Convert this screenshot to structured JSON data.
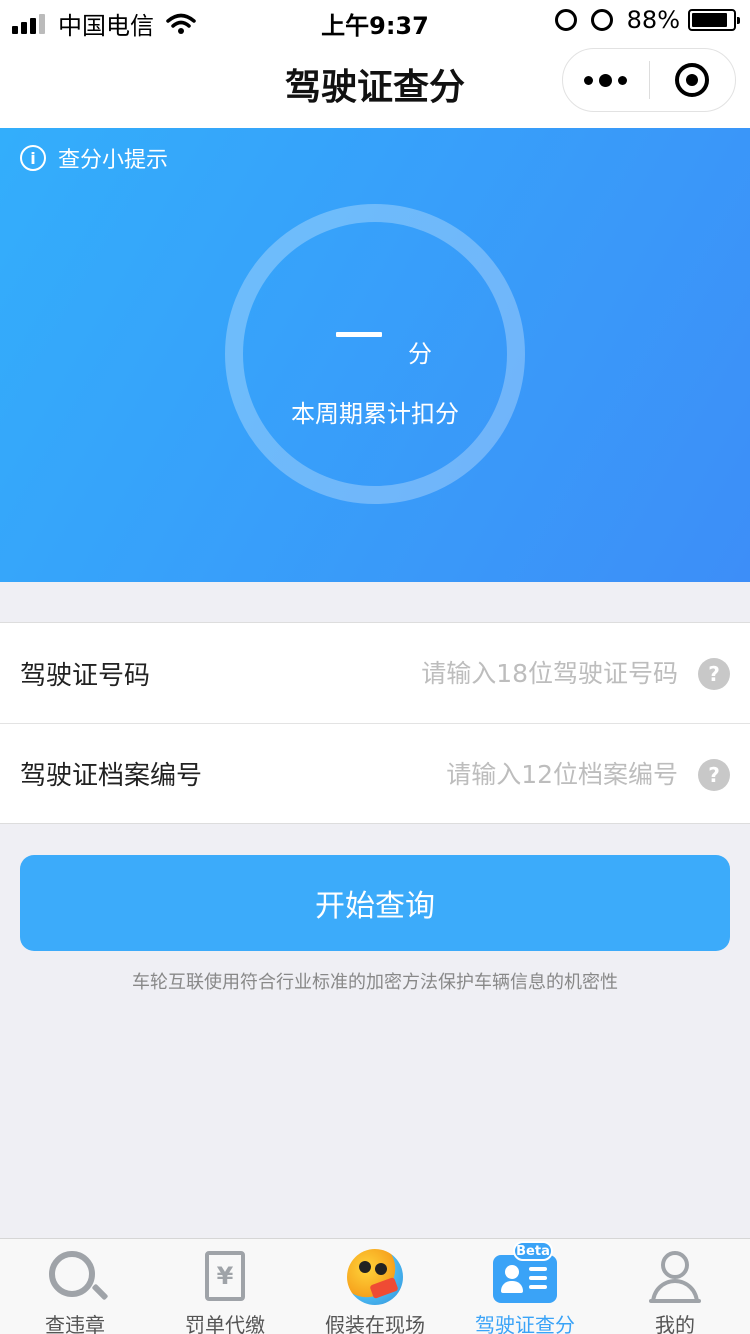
{
  "status_bar": {
    "carrier": "中国电信",
    "time": "上午9:37",
    "battery": "88%",
    "battery_level": 0.88,
    "signal_bars": 3
  },
  "nav": {
    "title": "驾驶证查分",
    "more_icon": "more-dots-icon",
    "close_icon": "target-close-icon"
  },
  "hero": {
    "tip_label": "查分小提示",
    "score_value": "—",
    "score_unit": "分",
    "score_caption": "本周期累计扣分",
    "gradient": [
      "#33aefb",
      "#3d8ef8"
    ]
  },
  "form": {
    "license_label": "驾驶证号码",
    "license_placeholder": "请输入18位驾驶证号码",
    "file_label": "驾驶证档案编号",
    "file_placeholder": "请输入12位档案编号",
    "help_glyph": "?"
  },
  "submit_label": "开始查询",
  "security_note": "车轮互联使用符合行业标准的加密方法保护车辆信息的机密性",
  "tabs": [
    {
      "label": "查违章",
      "icon": "search-icon"
    },
    {
      "label": "罚单代缴",
      "icon": "receipt-yuan-icon",
      "glyph": "¥"
    },
    {
      "label": "假装在现场",
      "icon": "mascot-icon"
    },
    {
      "label": "驾驶证查分",
      "icon": "id-card-icon",
      "badge": "Beta",
      "active": true
    },
    {
      "label": "我的",
      "icon": "person-icon"
    }
  ],
  "colors": {
    "accent": "#3cabfa",
    "active_tab": "#3aa3f7",
    "background": "#efeff4"
  }
}
